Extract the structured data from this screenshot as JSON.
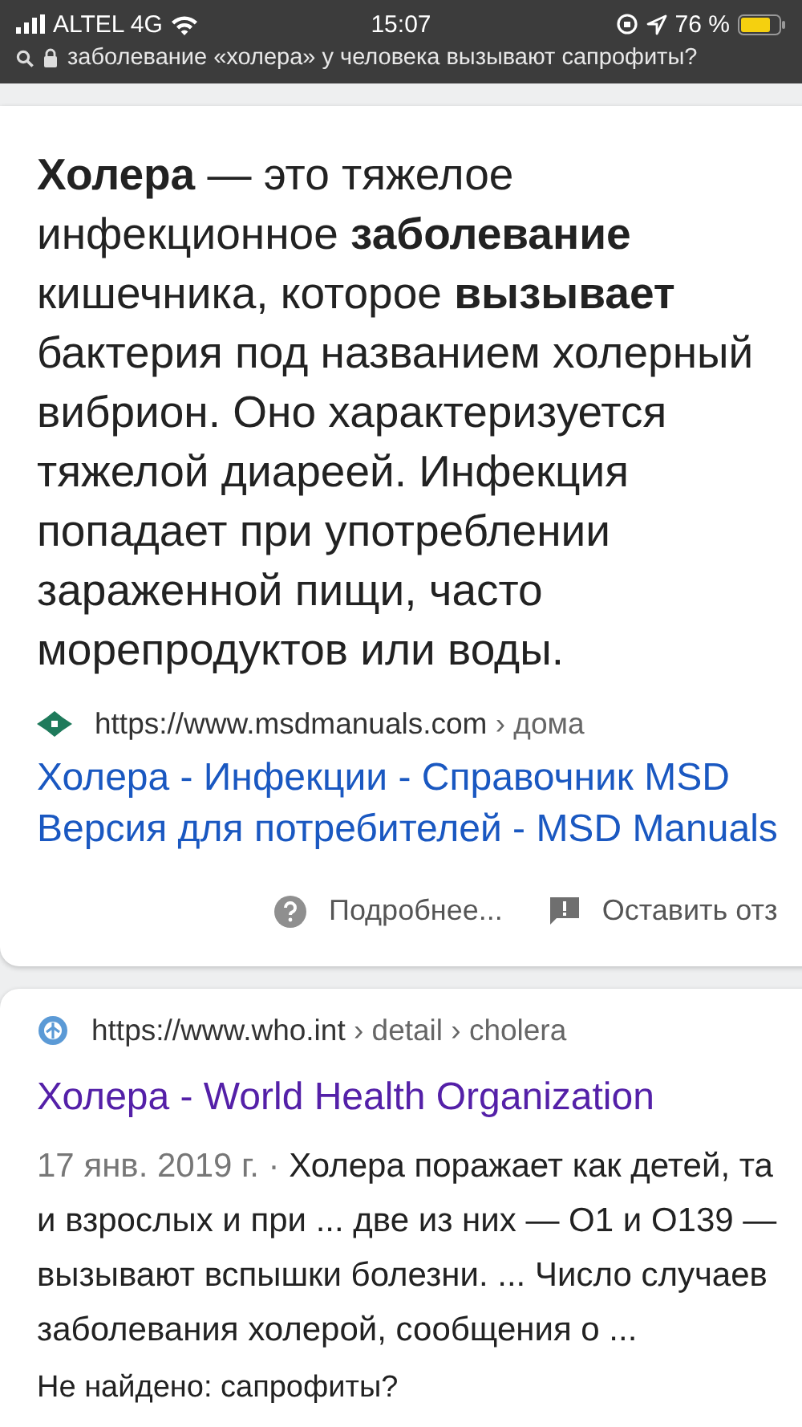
{
  "status_bar": {
    "carrier": "ALTEL 4G",
    "time": "15:07",
    "battery": "76 %"
  },
  "address_bar": {
    "query": "заболевание «холера» у человека вызывают сапрофиты?"
  },
  "featured_snippet": {
    "text": "**Холера** — это тяжелое\nинфекционное **заболевание**\nкишечника, которое **вызывает**\nбактерия под названием холерный\nвибрион. Оно характеризуется\nтяжелой диареей. Инфекция\nпопадает при употреблении\nзараженной пищи, часто\nморепродуктов или воды.",
    "url": "https://www.msdmanuals.com",
    "breadcrumb": "› дома",
    "title": "Холера - Инфекции - Справочник MSD\nВерсия для потребителей - MSD Manuals",
    "actions": [
      "Подробнее...",
      "Оставить отз"
    ]
  },
  "result": {
    "url": "https://www.who.int",
    "breadcrumb": "› detail › cholera",
    "title": "Холера - World Health Organization",
    "date": "17 янв. 2019 г. ·",
    "snippet": "Холера поражает как детей, та\nи взрослых и при ... две из них — O1 и O139 —\nвызывают вспышки болезни. ... Число случаев\nзаболевания холерой, сообщения о ...",
    "missing": "Не найдено: сапрофиты?"
  }
}
